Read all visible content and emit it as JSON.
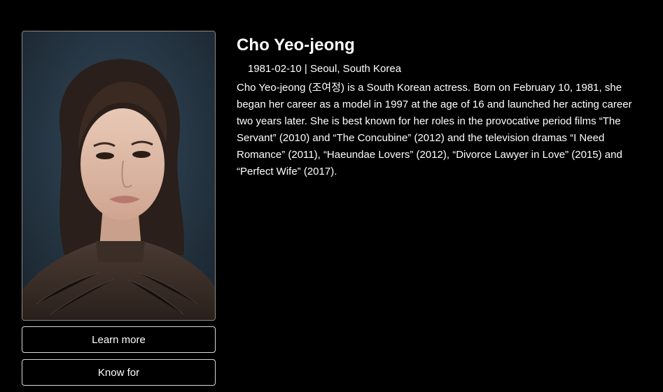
{
  "profile": {
    "name": "Cho Yeo-jeong",
    "birth_date": "1981-02-10",
    "separator": "|",
    "birthplace": "Seoul, South Korea",
    "bio": "Cho Yeo-jeong (조여정) is a South Korean actress. Born on February 10, 1981, she began her career as a model in 1997 at the age of 16 and launched her acting career two years later. She is best known for her roles in the provocative period films “The Servant” (2010) and “The Concubine” (2012) and the television dramas “I Need Romance” (2011), “Haeundae Lovers” (2012), “Divorce Lawyer in Love” (2015) and “Perfect Wife” (2017)."
  },
  "actions": {
    "learn_more_label": "Learn more",
    "known_for_label": "Know for"
  },
  "colors": {
    "background": "#000000",
    "text": "#ffffff",
    "button_border": "#d8d8d8"
  }
}
